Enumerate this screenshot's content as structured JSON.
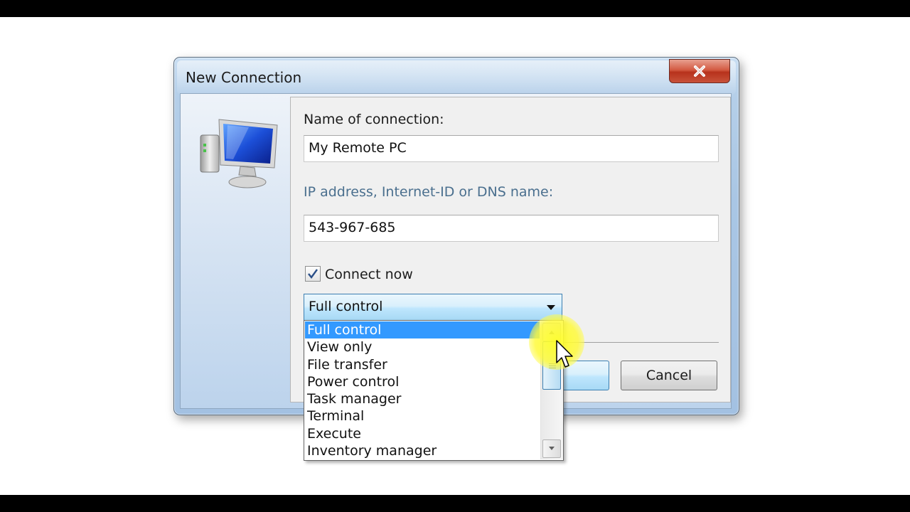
{
  "dialog": {
    "title": "New Connection",
    "close_icon": "close-icon"
  },
  "form": {
    "name_label": "Name of connection:",
    "name_value": "My Remote PC",
    "address_label": "IP address, Internet-ID or DNS name:",
    "address_value": "543-967-685",
    "connect_now_label": "Connect now",
    "connect_now_checked": true,
    "mode_selected": "Full control"
  },
  "dropdown": {
    "options": [
      "Full control",
      "View only",
      "File transfer",
      "Power control",
      "Task manager",
      "Terminal",
      "Execute",
      "Inventory manager"
    ],
    "selected_index": 0
  },
  "buttons": {
    "cancel_label": "Cancel"
  },
  "colors": {
    "selection": "#3399ff",
    "accent": "#3c7fb1",
    "close_red": "#c8523a"
  }
}
